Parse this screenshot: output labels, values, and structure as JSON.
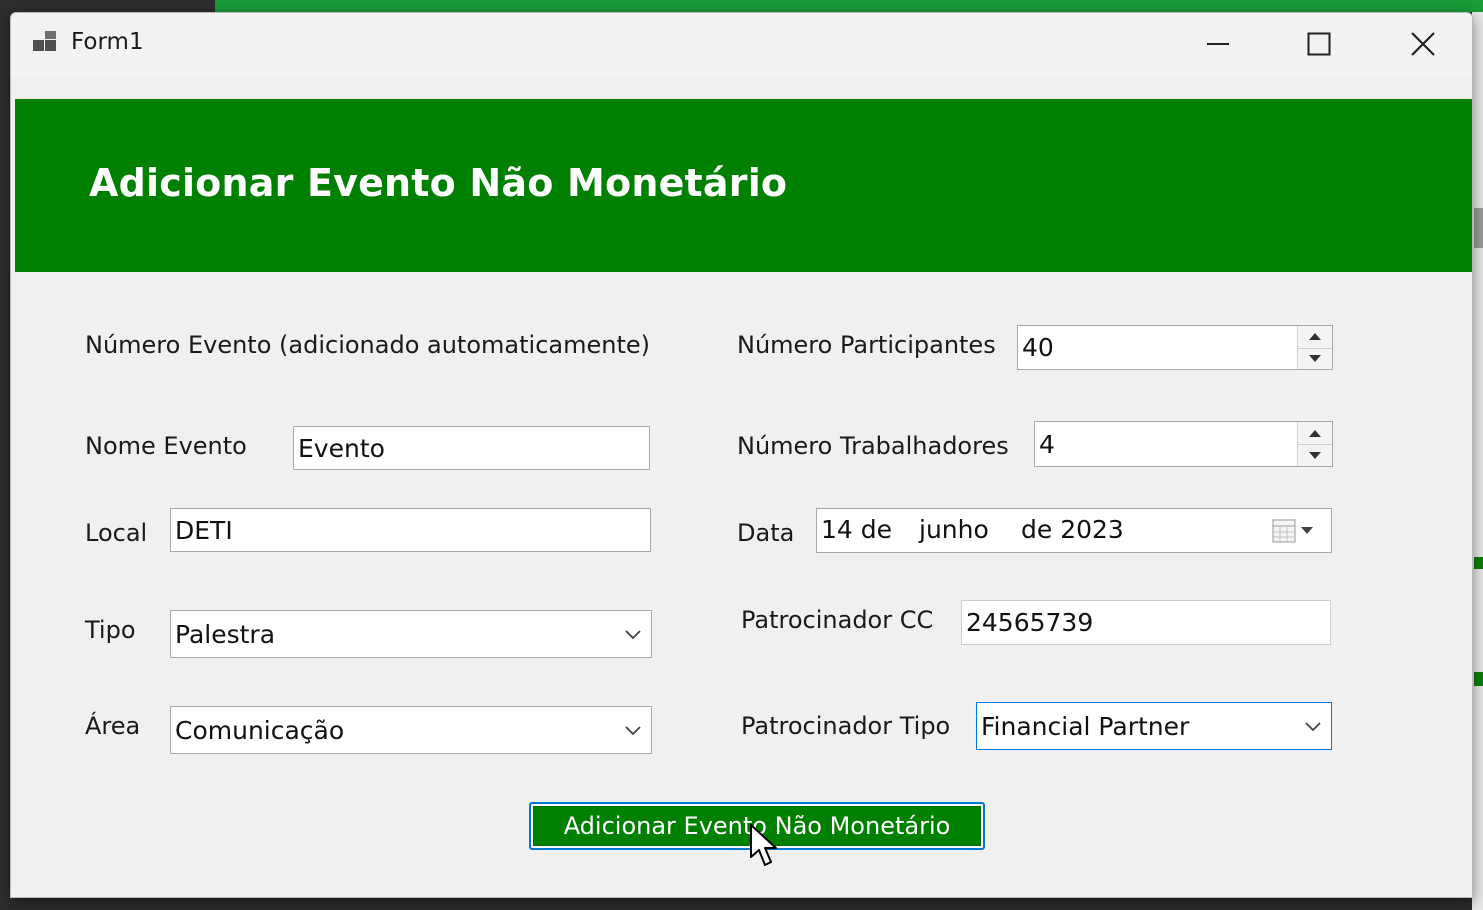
{
  "window": {
    "title": "Form1",
    "minimize_icon": "minimize-icon",
    "maximize_icon": "maximize-icon",
    "close_icon": "close-icon"
  },
  "header": {
    "title": "Adicionar Evento Não Monetário",
    "background_color": "#008000"
  },
  "form": {
    "numero_evento_label": "Número Evento (adicionado automaticamente)",
    "nome_evento": {
      "label": "Nome Evento",
      "value": "Evento"
    },
    "local": {
      "label": "Local",
      "value": "DETI"
    },
    "tipo": {
      "label": "Tipo",
      "value": "Palestra"
    },
    "area": {
      "label": "Área",
      "value": "Comunicação"
    },
    "numero_participantes": {
      "label": "Número Participantes",
      "value": "40"
    },
    "numero_trabalhadores": {
      "label": "Número Trabalhadores",
      "value": "4"
    },
    "data": {
      "label": "Data",
      "day": "14 de",
      "month": "junho",
      "year": "de 2023"
    },
    "patrocinador_cc": {
      "label": "Patrocinador CC",
      "value": "24565739"
    },
    "patrocinador_tipo": {
      "label": "Patrocinador Tipo",
      "value": "Financial Partner"
    }
  },
  "submit_button": {
    "label": "Adicionar Evento Não Monetário"
  },
  "colors": {
    "accent": "#008000",
    "focus_border": "#0078d7"
  }
}
